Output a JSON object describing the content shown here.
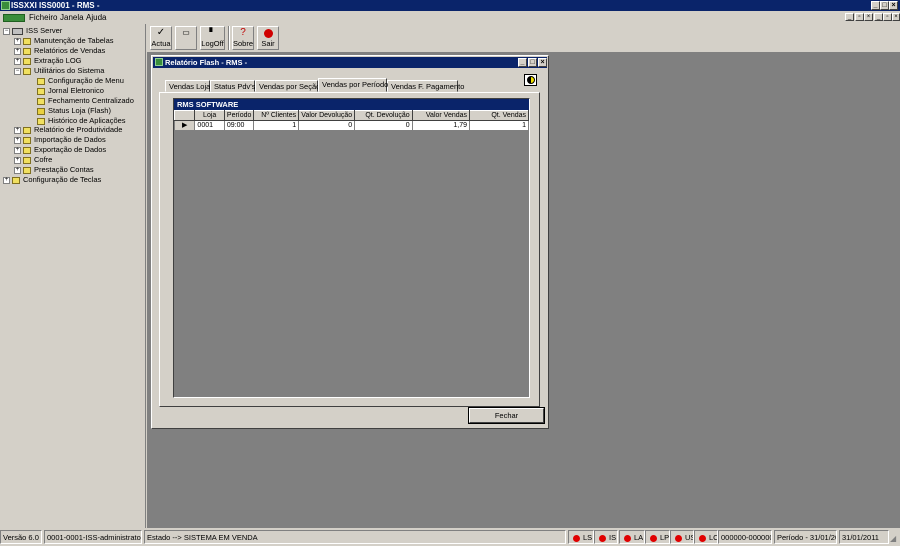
{
  "app": {
    "title": "ISSXXI ISS0001 - RMS -"
  },
  "menu": [
    "Ficheiro",
    "Janela",
    "Ajuda"
  ],
  "tree": {
    "root": "ISS Server",
    "items": [
      "Manutenção de Tabelas",
      "Relatórios de Vendas",
      "Extração LOG",
      "Utilitários do Sistema"
    ],
    "sub": [
      "Configuração de Menu",
      "Jornal Eletronico",
      "Fechamento Centralizado",
      "Status Loja (Flash)",
      "Histórico de Aplicações"
    ],
    "items2": [
      "Relatório de Produtividade",
      "Importação de Dados",
      "Exportação de Dados",
      "Cofre",
      "Prestação Contas"
    ],
    "last": "Configuração de Teclas"
  },
  "toolbar": {
    "actua": "Actua",
    "logoff": "LogOff",
    "sobre": "Sobre",
    "sair": "Sair"
  },
  "window": {
    "title": "Relatório Flash - RMS -",
    "tabs": [
      "Vendas Loja",
      "Status Pdv's",
      "Vendas por Seção",
      "Vendas por Período",
      "Vendas F. Pagamento"
    ],
    "grid_title": "RMS SOFTWARE",
    "columns": [
      "Loja",
      "Período",
      "Nº Clientes",
      "Valor Devolução",
      "Qt. Devolução",
      "Valor Vendas",
      "Qt. Vendas"
    ],
    "rows": [
      [
        "0001",
        "09:00",
        "1",
        "0",
        "0",
        "1,79",
        "1"
      ]
    ],
    "close": "Fechar"
  },
  "status": {
    "version": "Versão 6.0",
    "user": "0001-0001-ISS-administrator",
    "state": "Estado --> SISTEMA EM VENDA",
    "indicators": [
      "LS",
      "IS",
      "LA",
      "LP",
      "US",
      "LC"
    ],
    "code": "000000-000000",
    "period": "Período - 31/01/2011",
    "date": "31/01/2011"
  }
}
